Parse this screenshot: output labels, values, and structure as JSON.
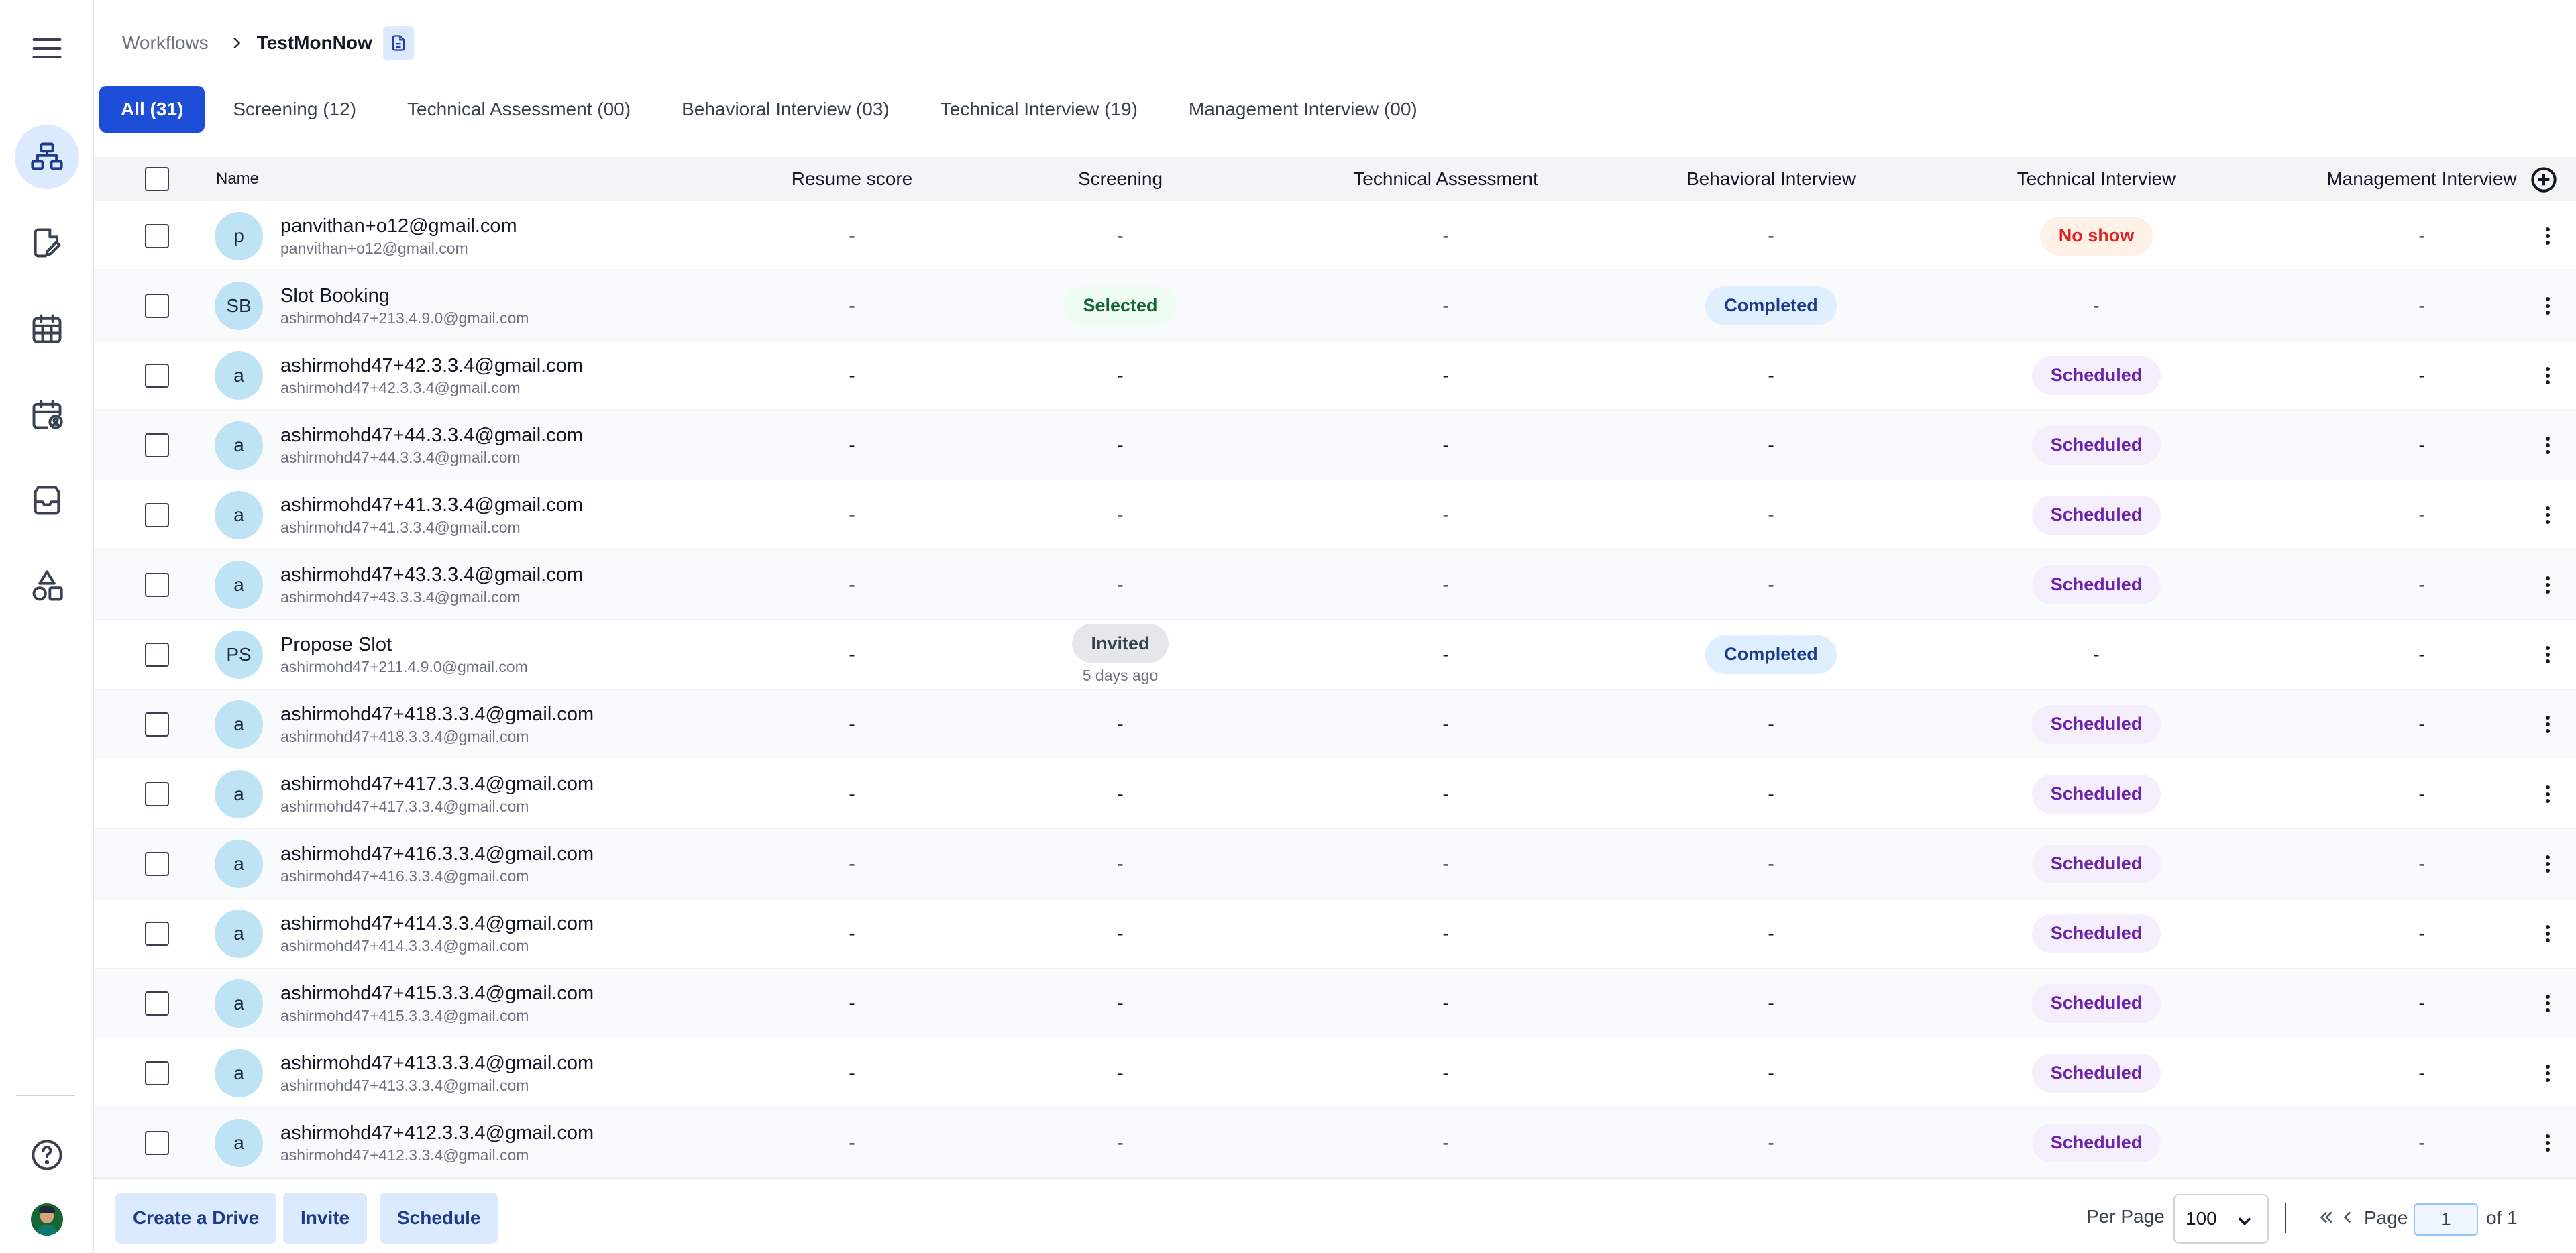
{
  "breadcrumb": {
    "root": "Workflows",
    "current": "TestMonNow"
  },
  "tabs": [
    {
      "label": "All (31)",
      "active": true
    },
    {
      "label": "Screening (12)"
    },
    {
      "label": "Technical Assessment (00)"
    },
    {
      "label": "Behavioral Interview (03)"
    },
    {
      "label": "Technical Interview (19)"
    },
    {
      "label": "Management Interview (00)"
    }
  ],
  "columns": {
    "name": "Name",
    "resume": "Resume score",
    "screening": "Screening",
    "tech_assessment": "Technical Assessment",
    "behavioral": "Behavioral Interview",
    "tech_interview": "Technical Interview",
    "management": "Management Interview"
  },
  "dash": "-",
  "rows": [
    {
      "initials": "p",
      "name": "panvithan+o12@gmail.com",
      "email": "panvithan+o12@gmail.com",
      "resume": "-",
      "screening": "-",
      "tech_assessment": "-",
      "behavioral": "-",
      "tech_interview": "No show",
      "management": "-"
    },
    {
      "initials": "SB",
      "name": "Slot Booking",
      "email": "ashirmohd47+213.4.9.0@gmail.com",
      "resume": "-",
      "screening": "Selected",
      "tech_assessment": "-",
      "behavioral": "Completed",
      "tech_interview": "-",
      "management": "-"
    },
    {
      "initials": "a",
      "name": "ashirmohd47+42.3.3.4@gmail.com",
      "email": "ashirmohd47+42.3.3.4@gmail.com",
      "resume": "-",
      "screening": "-",
      "tech_assessment": "-",
      "behavioral": "-",
      "tech_interview": "Scheduled",
      "management": "-"
    },
    {
      "initials": "a",
      "name": "ashirmohd47+44.3.3.4@gmail.com",
      "email": "ashirmohd47+44.3.3.4@gmail.com",
      "resume": "-",
      "screening": "-",
      "tech_assessment": "-",
      "behavioral": "-",
      "tech_interview": "Scheduled",
      "management": "-"
    },
    {
      "initials": "a",
      "name": "ashirmohd47+41.3.3.4@gmail.com",
      "email": "ashirmohd47+41.3.3.4@gmail.com",
      "resume": "-",
      "screening": "-",
      "tech_assessment": "-",
      "behavioral": "-",
      "tech_interview": "Scheduled",
      "management": "-"
    },
    {
      "initials": "a",
      "name": "ashirmohd47+43.3.3.4@gmail.com",
      "email": "ashirmohd47+43.3.3.4@gmail.com",
      "resume": "-",
      "screening": "-",
      "tech_assessment": "-",
      "behavioral": "-",
      "tech_interview": "Scheduled",
      "management": "-"
    },
    {
      "initials": "PS",
      "name": "Propose Slot",
      "email": "ashirmohd47+211.4.9.0@gmail.com",
      "resume": "-",
      "screening": "Invited",
      "screening_time": "5 days ago",
      "tech_assessment": "-",
      "behavioral": "Completed",
      "tech_interview": "-",
      "management": "-"
    },
    {
      "initials": "a",
      "name": "ashirmohd47+418.3.3.4@gmail.com",
      "email": "ashirmohd47+418.3.3.4@gmail.com",
      "resume": "-",
      "screening": "-",
      "tech_assessment": "-",
      "behavioral": "-",
      "tech_interview": "Scheduled",
      "management": "-"
    },
    {
      "initials": "a",
      "name": "ashirmohd47+417.3.3.4@gmail.com",
      "email": "ashirmohd47+417.3.3.4@gmail.com",
      "resume": "-",
      "screening": "-",
      "tech_assessment": "-",
      "behavioral": "-",
      "tech_interview": "Scheduled",
      "management": "-"
    },
    {
      "initials": "a",
      "name": "ashirmohd47+416.3.3.4@gmail.com",
      "email": "ashirmohd47+416.3.3.4@gmail.com",
      "resume": "-",
      "screening": "-",
      "tech_assessment": "-",
      "behavioral": "-",
      "tech_interview": "Scheduled",
      "management": "-"
    },
    {
      "initials": "a",
      "name": "ashirmohd47+414.3.3.4@gmail.com",
      "email": "ashirmohd47+414.3.3.4@gmail.com",
      "resume": "-",
      "screening": "-",
      "tech_assessment": "-",
      "behavioral": "-",
      "tech_interview": "Scheduled",
      "management": "-"
    },
    {
      "initials": "a",
      "name": "ashirmohd47+415.3.3.4@gmail.com",
      "email": "ashirmohd47+415.3.3.4@gmail.com",
      "resume": "-",
      "screening": "-",
      "tech_assessment": "-",
      "behavioral": "-",
      "tech_interview": "Scheduled",
      "management": "-"
    },
    {
      "initials": "a",
      "name": "ashirmohd47+413.3.3.4@gmail.com",
      "email": "ashirmohd47+413.3.3.4@gmail.com",
      "resume": "-",
      "screening": "-",
      "tech_assessment": "-",
      "behavioral": "-",
      "tech_interview": "Scheduled",
      "management": "-"
    },
    {
      "initials": "a",
      "name": "ashirmohd47+412.3.3.4@gmail.com",
      "email": "ashirmohd47+412.3.3.4@gmail.com",
      "resume": "-",
      "screening": "-",
      "tech_assessment": "-",
      "behavioral": "-",
      "tech_interview": "Scheduled",
      "management": "-"
    }
  ],
  "status_colors": {
    "No show": "#dc2626",
    "Selected": "#166534",
    "Completed": "#1e3a8a",
    "Scheduled": "#6b21a8",
    "Invited": "#374151"
  },
  "footer": {
    "create_drive": "Create a Drive",
    "invite": "Invite",
    "schedule": "Schedule",
    "per_page_label": "Per Page",
    "per_page_value": "100",
    "page_label": "Page",
    "page_value": "1",
    "page_of": "of 1"
  },
  "sidebar_icons": [
    "menu-icon",
    "workflow-icon",
    "edit-document-icon",
    "calendar-icon",
    "calendar-user-icon",
    "inbox-icon",
    "shapes-icon",
    "help-icon"
  ]
}
